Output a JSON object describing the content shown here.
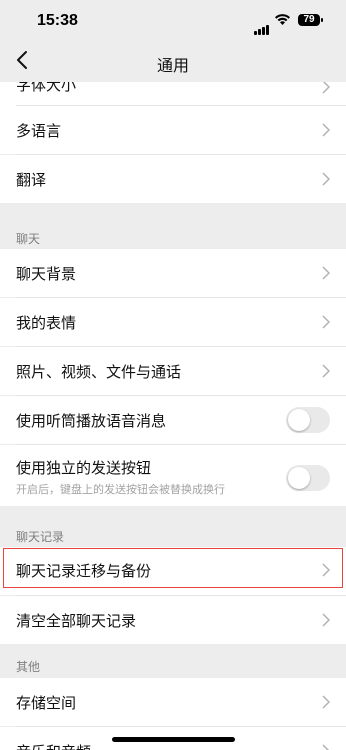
{
  "status_bar": {
    "time": "15:38",
    "battery": "79"
  },
  "nav": {
    "title": "通用"
  },
  "rows": {
    "font_size": "字体大小",
    "language": "多语言",
    "translate": "翻译",
    "chat_background": "聊天背景",
    "my_stickers": "我的表情",
    "media_files": "照片、视频、文件与通话",
    "earpiece_voice": "使用听筒播放语音消息",
    "send_button": "使用独立的发送按钮",
    "send_button_sub": "开启后，键盘上的发送按钮会被替换成换行",
    "migrate_backup": "聊天记录迁移与备份",
    "clear_history": "清空全部聊天记录",
    "storage": "存储空间",
    "music_audio": "音乐和音频"
  },
  "sections": {
    "chat": "聊天",
    "chat_history": "聊天记录",
    "other": "其他"
  },
  "toggles": {
    "earpiece_voice": false,
    "send_button": false
  },
  "colors": {
    "background": "#ededed",
    "highlight": "#e8453c"
  }
}
